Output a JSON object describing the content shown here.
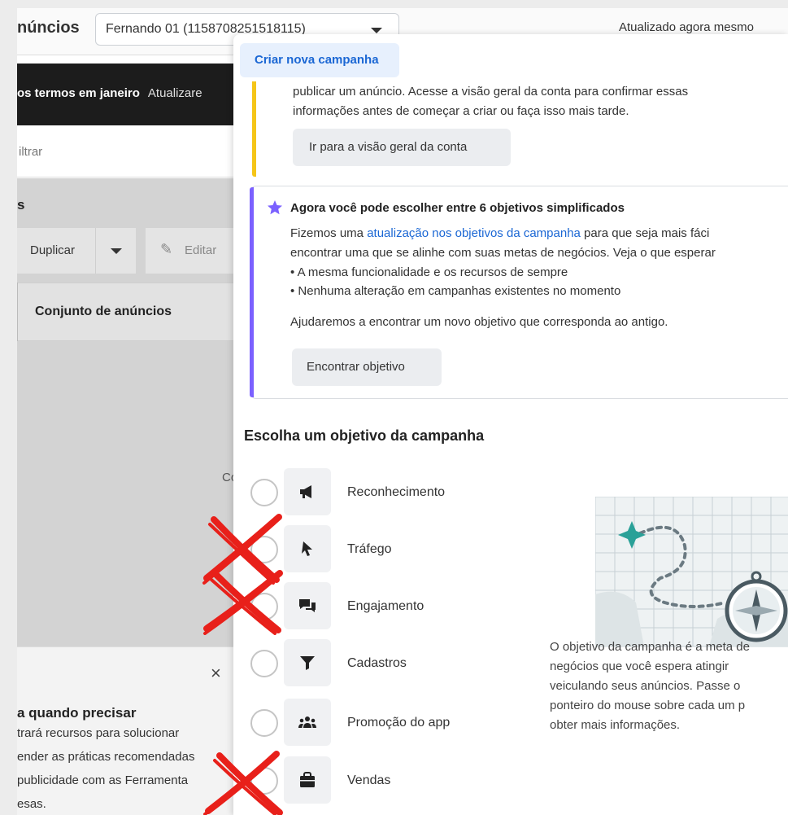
{
  "background": {
    "page_title": "núncios",
    "account_selector": "Fernando 01 (1158708251518115)",
    "updated_status": "Atualizado agora mesmo",
    "notice_bold": "os termos em janeiro",
    "notice_link": "Atualizare",
    "filter_placeholder": "iltrar",
    "section_label": "s",
    "duplicate_label": "Duplicar",
    "edit_label": "Editar",
    "column_header": "Conjunto de anúncios",
    "truncated_text": "Co",
    "help_close": "×",
    "help_title": "a quando precisar",
    "help_lines": [
      "trará recursos para solucionar",
      "ender as práticas recomendadas",
      "publicidade com as Ferramenta",
      "esas."
    ]
  },
  "modal": {
    "tab_label": "Criar nova campanha",
    "warning": {
      "lines": [
        "publicar um anúncio. Acesse a visão geral da conta para confirmar essas",
        "informações antes de começar a criar ou faça isso mais tarde."
      ],
      "button_label": "Ir para a visão geral da conta"
    },
    "info": {
      "title": "Agora você pode escolher entre 6 objetivos simplificados",
      "line1_pre": "Fizemos uma ",
      "line1_link": "atualização nos objetivos da campanha",
      "line1_post": " para que seja mais fáci",
      "line2": "encontrar uma que se alinhe com suas metas de negócios. Veja o que esperar",
      "bullet1": "• A mesma funcionalidade e os recursos de sempre",
      "bullet2": "• Nenhuma alteração em campanhas existentes no momento",
      "line3": "Ajudaremos a encontrar um novo objetivo que corresponda ao antigo.",
      "button_label": "Encontrar objetivo"
    },
    "objectives_title": "Escolha um objetivo da campanha",
    "objectives": [
      {
        "label": "Reconhecimento",
        "icon": "megaphone-icon",
        "crossed_out": false
      },
      {
        "label": "Tráfego",
        "icon": "cursor-icon",
        "crossed_out": true
      },
      {
        "label": "Engajamento",
        "icon": "chat-bubbles-icon",
        "crossed_out": true
      },
      {
        "label": "Cadastros",
        "icon": "funnel-icon",
        "crossed_out": false
      },
      {
        "label": "Promoção do app",
        "icon": "people-icon",
        "crossed_out": false
      },
      {
        "label": "Vendas",
        "icon": "shopping-bag-icon",
        "crossed_out": true
      }
    ],
    "description_lines": [
      "O objetivo da campanha é a meta de",
      "negócios que você espera atingir",
      "veiculando seus anúncios. Passe o",
      "ponteiro do mouse sobre cada um p",
      "obter mais informações."
    ]
  },
  "colors": {
    "accent_blue": "#1b67d4",
    "warning_yellow": "#f5c518",
    "info_purple": "#7b61ff",
    "cross_red": "#e8201a"
  }
}
